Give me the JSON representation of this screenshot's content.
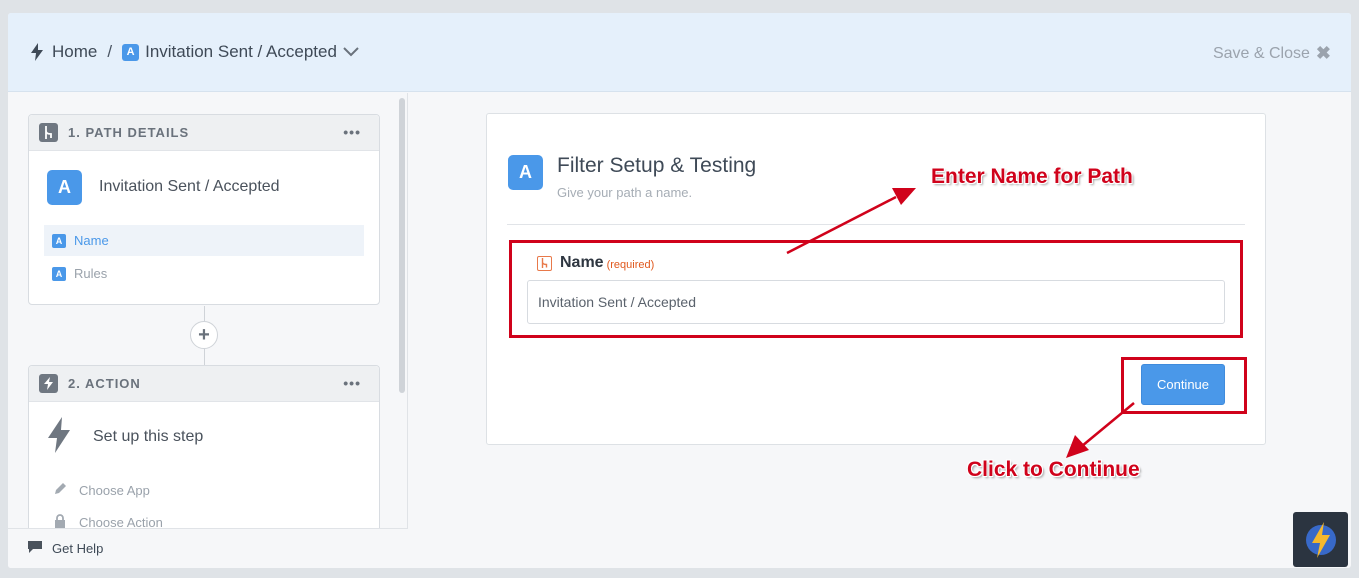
{
  "header": {
    "home_label": "Home",
    "separator": "/",
    "path_badge": "A",
    "path_name": "Invitation Sent / Accepted",
    "save_close_label": "Save & Close",
    "close_glyph": "✖"
  },
  "sidebar": {
    "step1": {
      "title": "1. PATH DETAILS",
      "menu_dots": "•••",
      "badge": "A",
      "name": "Invitation Sent / Accepted",
      "items": [
        {
          "badge": "A",
          "label": "Name"
        },
        {
          "badge": "A",
          "label": "Rules"
        }
      ]
    },
    "add_step_glyph": "+",
    "step2": {
      "title": "2. ACTION",
      "menu_dots": "•••",
      "name": "Set up this step",
      "items": [
        {
          "label": "Choose App"
        },
        {
          "label": "Choose Action"
        }
      ]
    },
    "help_label": "Get Help"
  },
  "panel": {
    "badge": "A",
    "title": "Filter Setup & Testing",
    "subtitle": "Give your path a name.",
    "field_label": "Name",
    "field_required": "(required)",
    "field_value": "Invitation Sent / Accepted",
    "continue_label": "Continue"
  },
  "annotations": {
    "enter_name": "Enter Name for Path",
    "click_continue": "Click to Continue"
  },
  "colors": {
    "accent": "#4a98e9",
    "annotation": "#d0021b",
    "required": "#e0581d"
  }
}
